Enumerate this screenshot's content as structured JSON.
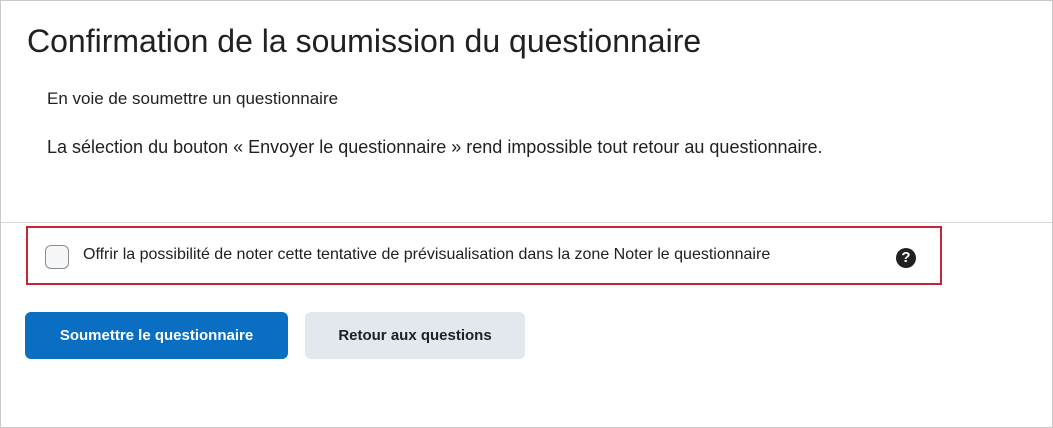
{
  "page": {
    "title": "Confirmation de la soumission du questionnaire",
    "subtitle": "En voie de soumettre un questionnaire",
    "warning": "La sélection du bouton « Envoyer le questionnaire » rend impossible tout retour au questionnaire."
  },
  "grading_option": {
    "label": "Offrir la possibilité de noter cette tentative de prévisualisation dans la zone Noter le questionnaire",
    "checked": false,
    "help_icon_glyph": "?",
    "highlight_color": "#c8262e"
  },
  "actions": {
    "submit_label": "Soumettre le questionnaire",
    "back_label": "Retour aux questions",
    "primary_color": "#0a6fc2",
    "secondary_color": "#e3e8ef"
  }
}
